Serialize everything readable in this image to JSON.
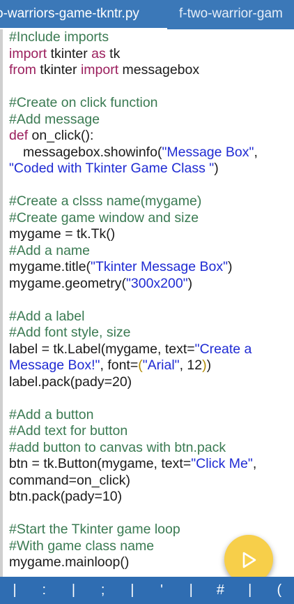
{
  "tabs": [
    {
      "label": "o-warriors-game-tkntr.py",
      "active": true
    },
    {
      "label": "f-two-warrior-gam",
      "active": false
    }
  ],
  "code_lines": [
    [
      {
        "t": "c",
        "v": "#Include imports"
      }
    ],
    [
      {
        "t": "k",
        "v": "import"
      },
      {
        "t": "n",
        "v": " tkinter "
      },
      {
        "t": "k",
        "v": "as"
      },
      {
        "t": "n",
        "v": " tk"
      }
    ],
    [
      {
        "t": "k",
        "v": "from"
      },
      {
        "t": "n",
        "v": " tkinter "
      },
      {
        "t": "k",
        "v": "import"
      },
      {
        "t": "n",
        "v": " messagebox"
      }
    ],
    [],
    [
      {
        "t": "c",
        "v": "#Create on click function"
      }
    ],
    [
      {
        "t": "c",
        "v": "#Add message"
      }
    ],
    [
      {
        "t": "k",
        "v": "def"
      },
      {
        "t": "n",
        "v": " on_click():"
      }
    ],
    [
      {
        "t": "n",
        "v": "messagebox.showinfo(",
        "i": true
      },
      {
        "t": "s",
        "v": "\"Message Box\""
      },
      {
        "t": "n",
        "v": ","
      }
    ],
    [
      {
        "t": "s",
        "v": "\"Coded with Tkinter Game Class \""
      },
      {
        "t": "n",
        "v": ")"
      }
    ],
    [],
    [
      {
        "t": "c",
        "v": "#Create a clsss name(mygame)"
      }
    ],
    [
      {
        "t": "c",
        "v": "#Create game window and size"
      }
    ],
    [
      {
        "t": "n",
        "v": "mygame = tk.Tk()"
      }
    ],
    [
      {
        "t": "c",
        "v": "#Add a name"
      }
    ],
    [
      {
        "t": "n",
        "v": "mygame.title("
      },
      {
        "t": "s",
        "v": "\"Tkinter Message Box\""
      },
      {
        "t": "n",
        "v": ")"
      }
    ],
    [
      {
        "t": "n",
        "v": "mygame.geometry("
      },
      {
        "t": "s",
        "v": "\"300x200\""
      },
      {
        "t": "n",
        "v": ")"
      }
    ],
    [],
    [
      {
        "t": "c",
        "v": "#Add a label"
      }
    ],
    [
      {
        "t": "c",
        "v": "#Add font style, size"
      }
    ],
    [
      {
        "t": "n",
        "v": "label = tk.Label(mygame, text="
      },
      {
        "t": "s",
        "v": "\"Create a"
      }
    ],
    [
      {
        "t": "s",
        "v": "Message Box!\""
      },
      {
        "t": "n",
        "v": ", font="
      },
      {
        "t": "p",
        "v": "("
      },
      {
        "t": "s",
        "v": "\"Arial\""
      },
      {
        "t": "n",
        "v": ", 12"
      },
      {
        "t": "p",
        "v": ")"
      },
      {
        "t": "n",
        "v": ")"
      }
    ],
    [
      {
        "t": "n",
        "v": "label.pack(pady=20)"
      }
    ],
    [],
    [
      {
        "t": "c",
        "v": "#Add a button"
      }
    ],
    [
      {
        "t": "c",
        "v": "#Add text for button"
      }
    ],
    [
      {
        "t": "c",
        "v": "#add button to canvas with btn.pack"
      }
    ],
    [
      {
        "t": "n",
        "v": "btn = tk.Button(mygame, text="
      },
      {
        "t": "s",
        "v": "\"Click Me\""
      },
      {
        "t": "n",
        "v": ","
      }
    ],
    [
      {
        "t": "n",
        "v": "command=on_click)"
      }
    ],
    [
      {
        "t": "n",
        "v": "btn.pack(pady=10)"
      }
    ],
    [],
    [
      {
        "t": "c",
        "v": "#Start the Tkinter game loop"
      }
    ],
    [
      {
        "t": "c",
        "v": "#With game class name"
      }
    ],
    [
      {
        "t": "n",
        "v": "mygame.mainloop()"
      }
    ]
  ],
  "run_button": {
    "icon": "play-icon",
    "color": "#f7cf4a"
  },
  "keybar": {
    "keys": [
      "|",
      ":",
      "|",
      ";",
      "|",
      "'",
      "|",
      "#",
      "|",
      "("
    ]
  },
  "colors": {
    "tabbar": "#3b78b8",
    "keybar": "#2f6db2",
    "comment": "#3a7a52",
    "keyword": "#9b1f5d",
    "string": "#1f2bd3"
  }
}
